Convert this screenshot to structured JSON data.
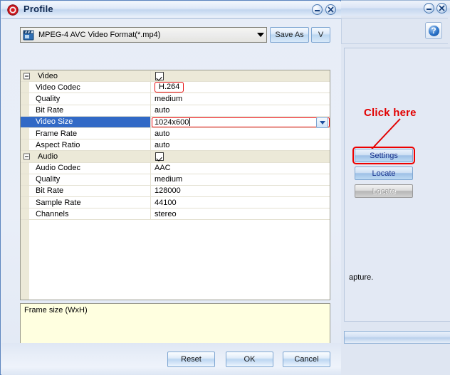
{
  "background_window": {
    "help_icon": "help-question-icon",
    "help_label": "?",
    "annotation": "Click here",
    "buttons": [
      {
        "label": "Settings",
        "state": "enabled",
        "highlighted": true
      },
      {
        "label": "Locate",
        "state": "enabled",
        "highlighted": false
      },
      {
        "label": "Locate",
        "state": "disabled",
        "highlighted": false
      }
    ],
    "body_text": "apture.",
    "minimize_icon": "minimize-icon",
    "close_icon": "close-icon"
  },
  "dialog": {
    "title": "Profile",
    "icon": "profile-gear-icon",
    "minimize_icon": "minimize-icon",
    "close_icon": "close-icon",
    "profile_select": {
      "icon": "video-clapper-icon",
      "value": "MPEG-4 AVC Video Format(*.mp4)",
      "dropdown_icon": "chevron-down-icon"
    },
    "save_as_label": "Save As",
    "v_label": "V",
    "grid": {
      "rows": [
        {
          "type": "group",
          "name": "Video",
          "value": "",
          "control": "checkbox"
        },
        {
          "type": "item",
          "name": "Video Codec",
          "value": "H.264",
          "control": "redbox"
        },
        {
          "type": "item",
          "name": "Quality",
          "value": "medium",
          "control": "text"
        },
        {
          "type": "item",
          "name": "Bit Rate",
          "value": "auto",
          "control": "text"
        },
        {
          "type": "item",
          "name": "Video Size",
          "value": "1024x600",
          "control": "editcombo",
          "selected": true
        },
        {
          "type": "item",
          "name": "Frame Rate",
          "value": "auto",
          "control": "text"
        },
        {
          "type": "item",
          "name": "Aspect Ratio",
          "value": "auto",
          "control": "text"
        },
        {
          "type": "group",
          "name": "Audio",
          "value": "",
          "control": "checkbox"
        },
        {
          "type": "item",
          "name": "Audio Codec",
          "value": "AAC",
          "control": "text"
        },
        {
          "type": "item",
          "name": "Quality",
          "value": "medium",
          "control": "text"
        },
        {
          "type": "item",
          "name": "Bit Rate",
          "value": "128000",
          "control": "text"
        },
        {
          "type": "item",
          "name": "Sample Rate",
          "value": "44100",
          "control": "text"
        },
        {
          "type": "item",
          "name": "Channels",
          "value": "stereo",
          "control": "text"
        }
      ]
    },
    "hint": "Frame size (WxH)",
    "footer": {
      "reset_label": "Reset",
      "ok_label": "OK",
      "cancel_label": "Cancel"
    }
  },
  "colors": {
    "selection_blue": "#3169c6",
    "annotation_red": "#e20000",
    "group_beige": "#ece9d8",
    "hint_yellow": "#ffffe0"
  }
}
